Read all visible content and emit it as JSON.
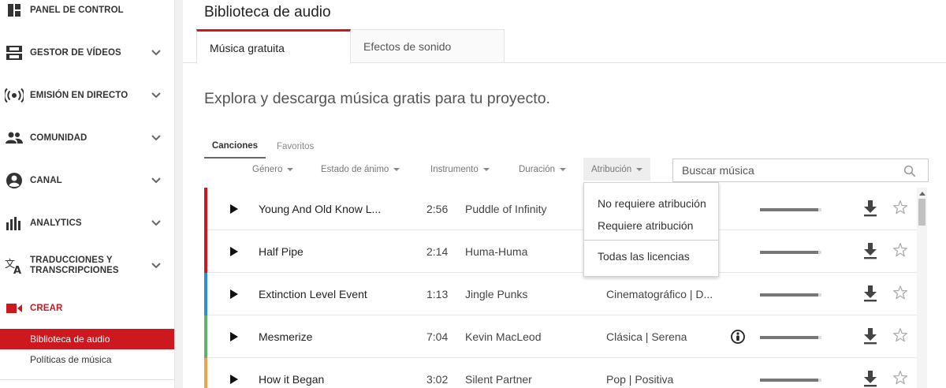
{
  "sidebar": {
    "items": [
      {
        "label": "PANEL DE CONTROL",
        "icon": "dashboard-icon",
        "chevron": false
      },
      {
        "label": "GESTOR DE VÍDEOS",
        "icon": "video-manager-icon",
        "chevron": true
      },
      {
        "label": "EMISIÓN EN DIRECTO",
        "icon": "live-broadcast-icon",
        "chevron": true
      },
      {
        "label": "COMUNIDAD",
        "icon": "community-icon",
        "chevron": true
      },
      {
        "label": "CANAL",
        "icon": "channel-icon",
        "chevron": true
      },
      {
        "label": "ANALYTICS",
        "icon": "analytics-icon",
        "chevron": true
      },
      {
        "label": "TRADUCCIONES Y TRANSCRIPCIONES",
        "icon": "translate-icon",
        "chevron": true
      }
    ],
    "create": {
      "label": "CREAR",
      "icon": "video-camera-icon"
    },
    "sub_items": [
      {
        "label": "Biblioteca de audio",
        "active": true
      },
      {
        "label": "Políticas de música",
        "active": false
      }
    ]
  },
  "header": {
    "title": "Biblioteca de audio"
  },
  "tabs": [
    {
      "label": "Música gratuita",
      "active": true
    },
    {
      "label": "Efectos de sonido",
      "active": false
    }
  ],
  "tagline": "Explora y descarga música gratis para tu proyecto.",
  "sub_tabs": [
    {
      "label": "Canciones",
      "active": true
    },
    {
      "label": "Favoritos",
      "active": false
    }
  ],
  "filters": [
    {
      "label": "Género"
    },
    {
      "label": "Estado de ánimo"
    },
    {
      "label": "Instrumento"
    },
    {
      "label": "Duración"
    },
    {
      "label": "Atribución",
      "open": true
    }
  ],
  "search": {
    "placeholder": "Buscar música",
    "value": ""
  },
  "dropdown": {
    "items": [
      {
        "label": "No requiere atribución"
      },
      {
        "label": "Requiere atribución"
      },
      {
        "label": "Todas las licencias"
      }
    ]
  },
  "tracks": [
    {
      "title": "Young And Old Know L...",
      "duration": "2:56",
      "artist": "Puddle of Infinity",
      "genre": "",
      "attribution_required": false,
      "popularity": 0.95,
      "accent": "#cc181e"
    },
    {
      "title": "Half Pipe",
      "duration": "2:14",
      "artist": "Huma-Huma",
      "genre": "",
      "attribution_required": false,
      "popularity": 0.95,
      "accent": "#cc181e"
    },
    {
      "title": "Extinction Level Event",
      "duration": "1:13",
      "artist": "Jingle Punks",
      "genre": "Cinematográfico | D...",
      "attribution_required": false,
      "popularity": 0.95,
      "accent": "#2b8fd6"
    },
    {
      "title": "Mesmerize",
      "duration": "7:04",
      "artist": "Kevin MacLeod",
      "genre": "Clásica | Serena",
      "attribution_required": true,
      "popularity": 0.95,
      "accent": "#5fb36a"
    },
    {
      "title": "How it Began",
      "duration": "3:02",
      "artist": "Silent Partner",
      "genre": "Pop | Positiva",
      "attribution_required": false,
      "popularity": 0.95,
      "accent": "#f0a04b"
    }
  ],
  "colors": {
    "accent": "#cc181e"
  }
}
